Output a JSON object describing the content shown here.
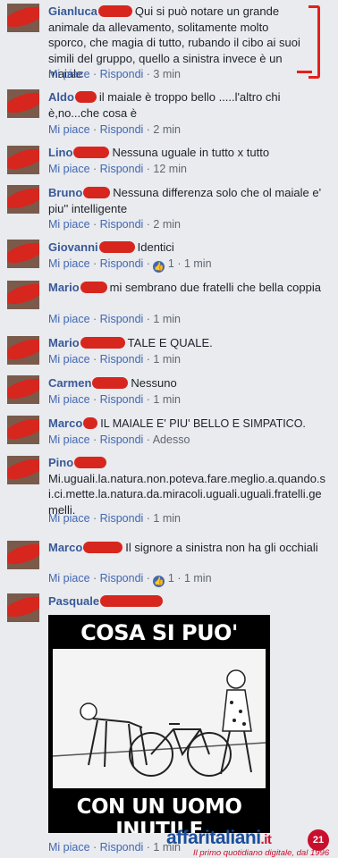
{
  "comments": [
    {
      "author": "Gianluca",
      "text": "Qui si può notare un grande animale da allevamento, solitamente molto sporco, che magia di tutto, rubando il cibo ai suoi simili del gruppo, quello a sinistra invece è un maiale",
      "like": "Mi piace",
      "reply": "Rispondi",
      "time": "3 min"
    },
    {
      "author": "Aldo",
      "text": "il maiale è troppo bello .....l'altro chi è,no...che cosa è",
      "like": "Mi piace",
      "reply": "Rispondi",
      "time": "2 min"
    },
    {
      "author": "Lino",
      "text": "Nessuna uguale in tutto x tutto",
      "like": "Mi piace",
      "reply": "Rispondi",
      "time": "12 min"
    },
    {
      "author": "Bruno",
      "text": "Nessuna differenza solo che ol maiale e' piu'' intelligente",
      "like": "Mi piace",
      "reply": "Rispondi",
      "time": "2 min"
    },
    {
      "author": "Giovanni",
      "text": "Identici",
      "like": "Mi piace",
      "reply": "Rispondi",
      "reactions": "1",
      "time": "1 min"
    },
    {
      "author": "Mario",
      "text": "mi sembrano due fratelli che bella coppia",
      "like": "Mi piace",
      "reply": "Rispondi",
      "time": "1 min"
    },
    {
      "author": "Mario",
      "text": "TALE E QUALE.",
      "like": "Mi piace",
      "reply": "Rispondi",
      "time": "1 min"
    },
    {
      "author": "Carmen",
      "text": "Nessuno",
      "like": "Mi piace",
      "reply": "Rispondi",
      "time": "1 min"
    },
    {
      "author": "Marco",
      "text": "IL MAIALE E' PIU' BELLO E SIMPATICO.",
      "like": "Mi piace",
      "reply": "Rispondi",
      "time": "Adesso"
    },
    {
      "author": "Pino",
      "text": "Mi.uguali.la.natura.non.poteva.fare.meglio.a.quando.si.ci.mette.la.natura.da.miracoli.uguali.uguali.fratelli.gemelli.",
      "like": "Mi piace",
      "reply": "Rispondi",
      "time": "1 min"
    },
    {
      "author": "Marco",
      "text": "Il signore a sinistra non ha gli occhiali",
      "like": "Mi piace",
      "reply": "Rispondi",
      "reactions": "1",
      "time": "1 min"
    },
    {
      "author": "Pasquale",
      "text": "",
      "like": "Mi piace",
      "reply": "Rispondi",
      "time": "1 min"
    }
  ],
  "meme": {
    "top_text": "COSA SI PUO' FARE",
    "bottom_text": "CON UN UOMO INUTILE"
  },
  "watermark": {
    "name": "affaritaliani",
    "tld": ".it",
    "tagline": "Il primo quotidiano digitale, dal 1996",
    "badge": "21"
  },
  "icons": {
    "reaction": "thumbs-up-icon"
  },
  "colors": {
    "author": "#385898",
    "link": "#4267b2",
    "meta": "#606770",
    "redaction": "#d7261e"
  }
}
